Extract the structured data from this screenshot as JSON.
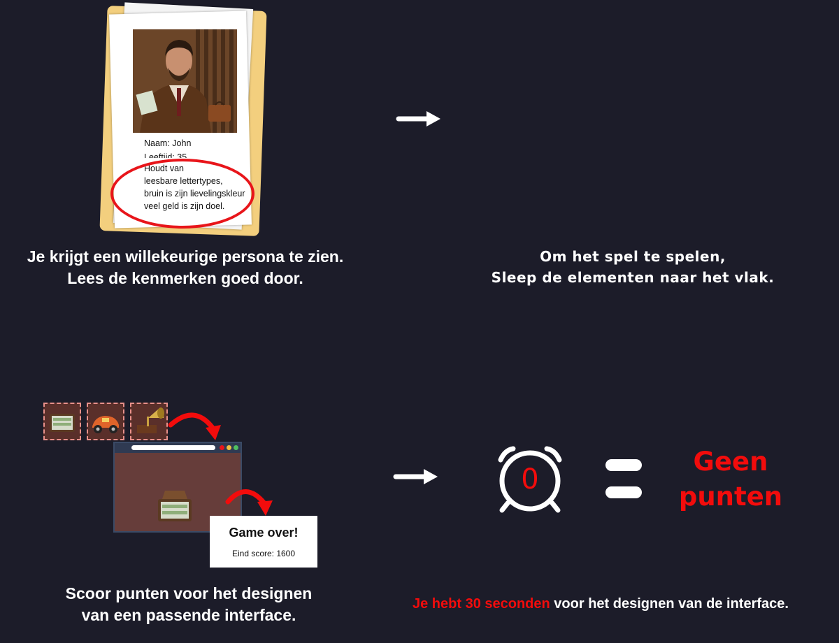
{
  "persona_card": {
    "name_line": "Naam: John",
    "age_line": "Leeftijd: 35",
    "likes_lines": [
      "Houdt van",
      "leesbare lettertypes,",
      "bruin is zijn lievelingskleur",
      "veel geld is zijn doel."
    ]
  },
  "step1": {
    "lines": [
      "Je krijgt een willekeurige persona te zien.",
      "Lees de kenmerken goed door."
    ]
  },
  "step2": {
    "lines": [
      "Om het spel te spelen,",
      "Sleep de elementen naar het vlak."
    ]
  },
  "step3": {
    "lines": [
      "Scoor punten voor het designen",
      "van een passende interface."
    ],
    "tiles": [
      {
        "icon": "money-briefcase-icon"
      },
      {
        "icon": "toy-car-icon"
      },
      {
        "icon": "gramophone-icon"
      }
    ],
    "game_over": {
      "title": "Game over!",
      "score": "Eind score: 1600"
    }
  },
  "step4": {
    "timer_value": "0",
    "result_lines": [
      "Geen",
      "punten"
    ],
    "note_highlight": "Je hebt 30 seconden",
    "note_rest": " voor het designen van de interface."
  },
  "colors": {
    "background": "#1c1c29",
    "accent_red": "#f20c0c",
    "folder": "#f3cf7e",
    "canvas_brown": "#663d3a"
  }
}
